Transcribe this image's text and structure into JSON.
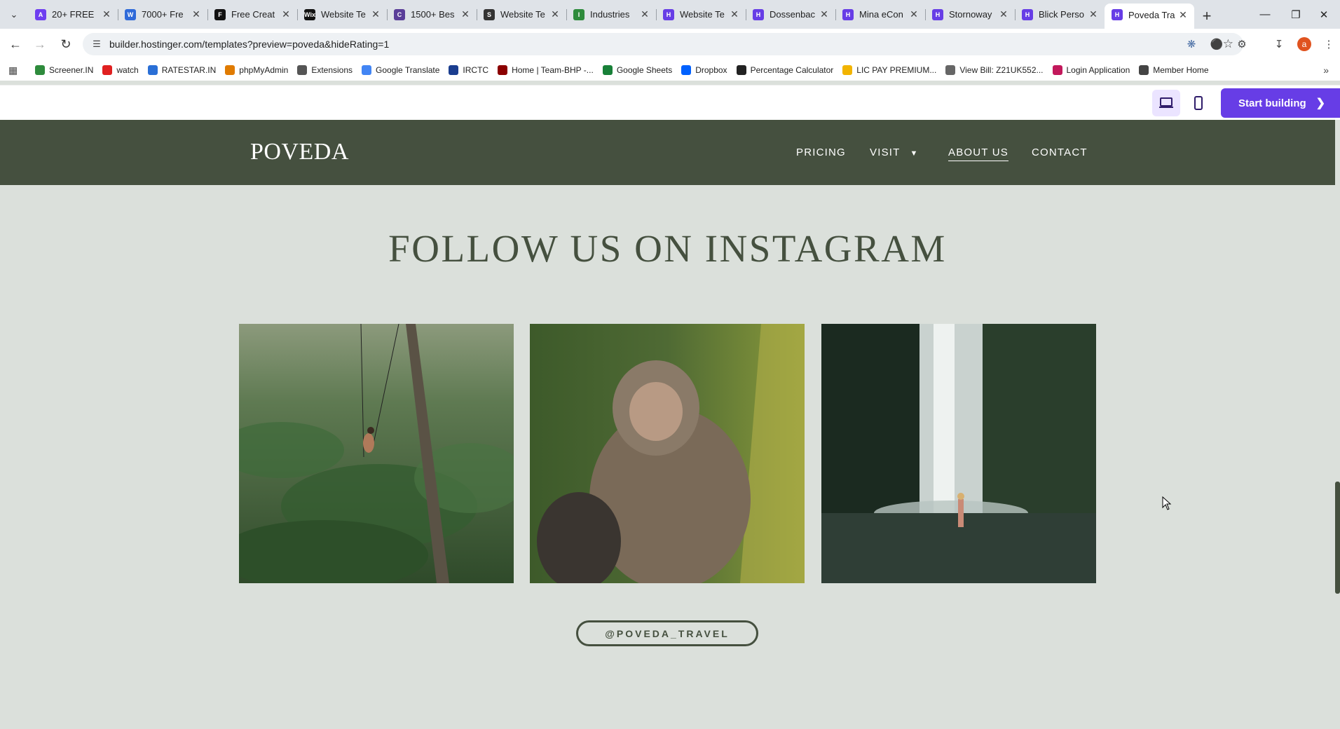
{
  "browser": {
    "tabs": [
      {
        "title": "20+ FREE",
        "color": "#6e3ef0",
        "glyph": "A"
      },
      {
        "title": "7000+ Fre",
        "color": "#2f6ad9",
        "glyph": "W"
      },
      {
        "title": "Free Creat",
        "color": "#111111",
        "glyph": "F"
      },
      {
        "title": "Website Te",
        "color": "#111111",
        "glyph": "Wix"
      },
      {
        "title": "1500+ Bes",
        "color": "#5a3e99",
        "glyph": "C"
      },
      {
        "title": "Website Te",
        "color": "#333333",
        "glyph": "S"
      },
      {
        "title": "Industries",
        "color": "#2e8b3c",
        "glyph": "I"
      },
      {
        "title": "Website Te",
        "color": "#673de6",
        "glyph": "H"
      },
      {
        "title": "Dossenbac",
        "color": "#673de6",
        "glyph": "H"
      },
      {
        "title": "Mina eCon",
        "color": "#673de6",
        "glyph": "H"
      },
      {
        "title": "Stornoway",
        "color": "#673de6",
        "glyph": "H"
      },
      {
        "title": "Blick Perso",
        "color": "#673de6",
        "glyph": "H"
      },
      {
        "title": "Poveda Tra",
        "color": "#673de6",
        "glyph": "H",
        "active": true
      }
    ],
    "url": "builder.hostinger.com/templates?preview=poveda&hideRating=1",
    "profile_initial": "a",
    "bookmarks": [
      {
        "label": "Screener.IN",
        "color": "#2e8b3c"
      },
      {
        "label": "watch",
        "color": "#e02020"
      },
      {
        "label": "RATESTAR.IN",
        "color": "#2a6fd6"
      },
      {
        "label": "phpMyAdmin",
        "color": "#e07b00"
      },
      {
        "label": "Extensions",
        "color": "#555555"
      },
      {
        "label": "Google Translate",
        "color": "#4285f4"
      },
      {
        "label": "IRCTC",
        "color": "#1a3d8f"
      },
      {
        "label": "Home | Team-BHP -...",
        "color": "#8b0000"
      },
      {
        "label": "Google Sheets",
        "color": "#188038"
      },
      {
        "label": "Dropbox",
        "color": "#0061fe"
      },
      {
        "label": "Percentage Calculator",
        "color": "#222222"
      },
      {
        "label": "LIC PAY PREMIUM...",
        "color": "#f2b400"
      },
      {
        "label": "View Bill: Z21UK552...",
        "color": "#666666"
      },
      {
        "label": "Login Application",
        "color": "#c2185b"
      },
      {
        "label": "Member Home",
        "color": "#444444"
      }
    ]
  },
  "builder": {
    "start_label": "Start building"
  },
  "site": {
    "logo": "POVEDA",
    "nav": {
      "pricing": "PRICING",
      "visit": "VISIT",
      "about": "ABOUT US",
      "contact": "CONTACT"
    },
    "section_title": "FOLLOW US ON INSTAGRAM",
    "handle": "@POVEDA_TRAVEL"
  },
  "colors": {
    "header_bg": "#45503f",
    "page_bg": "#dbe0db",
    "accent": "#673de6"
  }
}
